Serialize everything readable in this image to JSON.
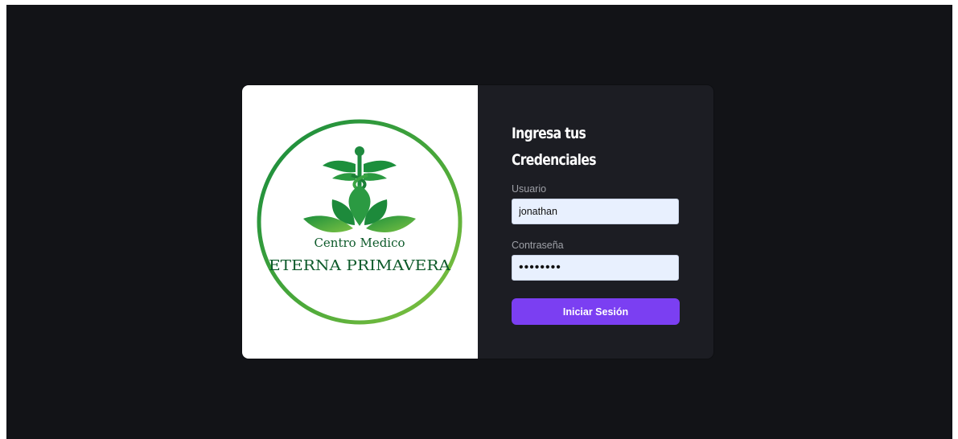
{
  "brand": {
    "logo_line1": "Centro Medico",
    "logo_line2": "ETERNA PRIMAVERA",
    "colors": {
      "ring_dark": "#1a8a3a",
      "ring_light": "#7bc142",
      "text_dark_green": "#0d5a2a"
    }
  },
  "login": {
    "heading_line1": "Ingresa tus",
    "heading_line2": "Credenciales",
    "username_label": "Usuario",
    "username_value": "jonathan",
    "password_label": "Contraseña",
    "password_value": "••••••••",
    "submit_label": "Iniciar Sesión"
  },
  "colors": {
    "page_bg": "#121317",
    "panel_bg": "#1c1d23",
    "input_bg": "#e8f0fe",
    "accent": "#7b3ff2"
  }
}
